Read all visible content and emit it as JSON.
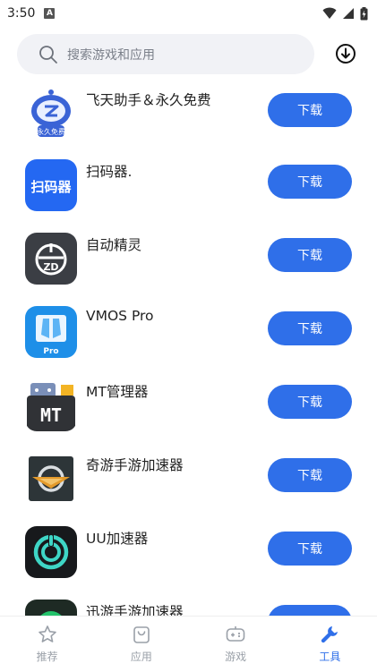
{
  "status_bar": {
    "time": "3:50",
    "notification_badge": "A"
  },
  "search": {
    "placeholder": "搜索游戏和应用"
  },
  "apps": [
    {
      "name": "飞天助手＆永久免费",
      "button": "下载",
      "icon_text": "永久免费"
    },
    {
      "name": "扫码器.",
      "button": "下载",
      "icon_text": "扫码器"
    },
    {
      "name": "自动精灵",
      "button": "下载",
      "icon_text": "ZD"
    },
    {
      "name": "VMOS Pro",
      "button": "下载",
      "icon_text": "Pro"
    },
    {
      "name": "MT管理器",
      "button": "下载",
      "icon_text": "MT"
    },
    {
      "name": "奇游手游加速器",
      "button": "下载"
    },
    {
      "name": "UU加速器",
      "button": "下载"
    },
    {
      "name": "迅游手游加速器",
      "button": "下载"
    }
  ],
  "tabs": [
    {
      "label": "推荐",
      "icon": "star-icon",
      "active": false
    },
    {
      "label": "应用",
      "icon": "bag-icon",
      "active": false
    },
    {
      "label": "游戏",
      "icon": "gamepad-icon",
      "active": false
    },
    {
      "label": "工具",
      "icon": "wrench-icon",
      "active": true
    }
  ],
  "colors": {
    "accent": "#2f6fe9",
    "inactive": "#9aa0a8",
    "search_bg": "#f1f2f6"
  }
}
